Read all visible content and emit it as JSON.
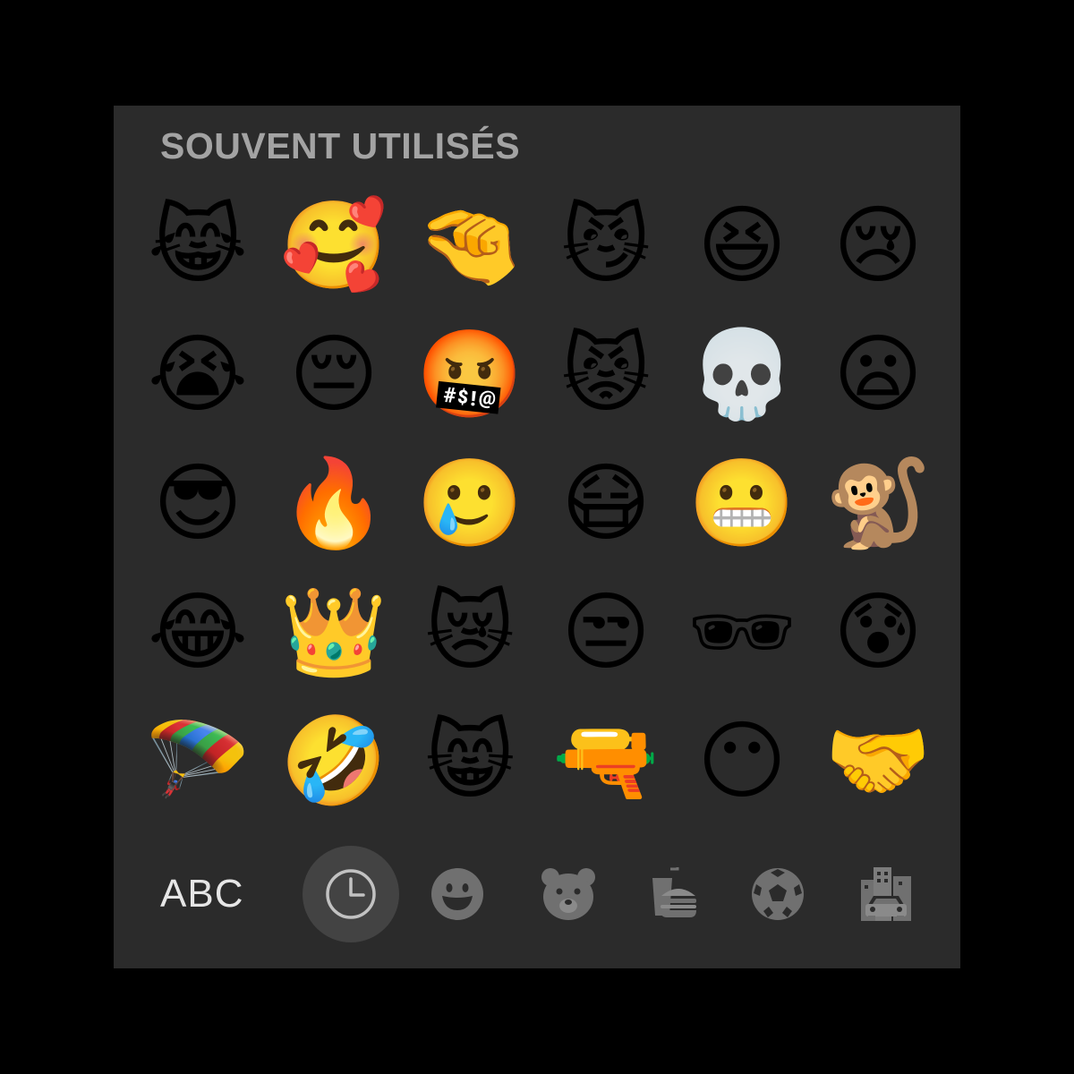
{
  "section_title": "SOUVENT UTILISÉS",
  "emoji_grid": [
    {
      "name": "cat-tears-of-joy",
      "glyph": "😹"
    },
    {
      "name": "smiling-face-with-hearts",
      "glyph": "🥰"
    },
    {
      "name": "pinching-hand",
      "glyph": "🤏"
    },
    {
      "name": "cat-wry-smile",
      "glyph": "😼"
    },
    {
      "name": "grinning-squinting-face",
      "glyph": "😆"
    },
    {
      "name": "crying-face",
      "glyph": "😢"
    },
    {
      "name": "loudly-crying-face",
      "glyph": "😭"
    },
    {
      "name": "pensive-face",
      "glyph": "😔"
    },
    {
      "name": "face-with-symbols-on-mouth",
      "glyph": "🤬"
    },
    {
      "name": "pouting-cat",
      "glyph": "😾"
    },
    {
      "name": "skull",
      "glyph": "💀"
    },
    {
      "name": "frowning-open-mouth-face",
      "glyph": "😦"
    },
    {
      "name": "smiling-face-with-sunglasses",
      "glyph": "😎"
    },
    {
      "name": "fire",
      "glyph": "🔥"
    },
    {
      "name": "face-holding-back-tears",
      "glyph": "🥲"
    },
    {
      "name": "face-with-medical-mask",
      "glyph": "😷"
    },
    {
      "name": "grimacing-face",
      "glyph": "😬"
    },
    {
      "name": "monkey",
      "glyph": "🐒"
    },
    {
      "name": "face-with-tears-of-joy",
      "glyph": "😂"
    },
    {
      "name": "crown",
      "glyph": "👑"
    },
    {
      "name": "crying-cat",
      "glyph": "😿"
    },
    {
      "name": "unamused-face",
      "glyph": "😒"
    },
    {
      "name": "dark-sunglasses",
      "glyph": "🕶"
    },
    {
      "name": "anxious-face-with-sweat",
      "glyph": "😰"
    },
    {
      "name": "parachute",
      "glyph": "🪂"
    },
    {
      "name": "rolling-on-the-floor-laughing",
      "glyph": "🤣"
    },
    {
      "name": "grinning-cat",
      "glyph": "😸"
    },
    {
      "name": "water-pistol",
      "glyph": "🔫"
    },
    {
      "name": "face-without-mouth",
      "glyph": "😶"
    },
    {
      "name": "handshake",
      "glyph": "🤝"
    }
  ],
  "category_bar": {
    "abc_label": "ABC",
    "selected": "recent",
    "categories": [
      {
        "id": "recent",
        "icon": "clock-icon"
      },
      {
        "id": "smileys",
        "icon": "smiley-icon"
      },
      {
        "id": "animals",
        "icon": "bear-icon"
      },
      {
        "id": "food",
        "icon": "burger-drink-icon"
      },
      {
        "id": "activity",
        "icon": "soccer-ball-icon"
      },
      {
        "id": "travel",
        "icon": "building-car-icon"
      }
    ]
  },
  "colors": {
    "background": "#2b2b2b",
    "title": "#a3a3a3",
    "icon_inactive": "#707070",
    "icon_active": "#c2c2c2",
    "selected_bg": "#434343"
  }
}
